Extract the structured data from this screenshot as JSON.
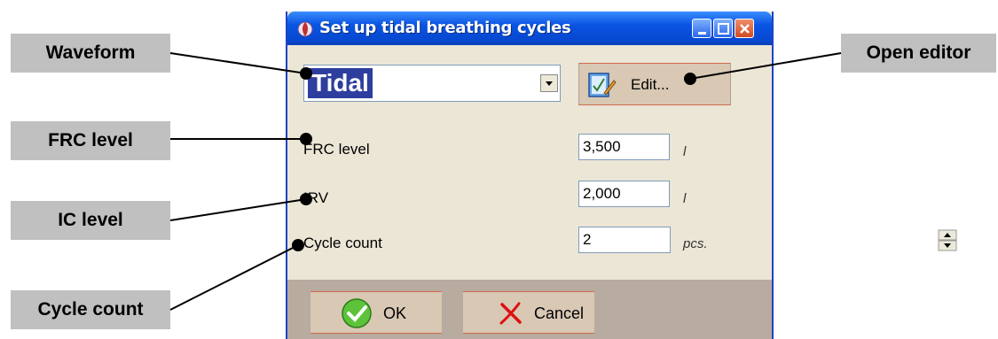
{
  "callouts": {
    "waveform": "Waveform",
    "frc_level": "FRC level",
    "ic_level": "IC level",
    "cycle_count": "Cycle count",
    "open_editor": "Open editor"
  },
  "dialog": {
    "title": "Set up tidal breathing cycles",
    "waveform_selected": "Tidal",
    "edit_label": "Edit...",
    "fields": [
      {
        "label": "FRC level",
        "value": "3,500",
        "unit": "l"
      },
      {
        "label": "IRV",
        "value": "2,000",
        "unit": "l"
      },
      {
        "label": "Cycle count",
        "value": "2",
        "unit": "pcs."
      }
    ],
    "ok_label": "OK",
    "cancel_label": "Cancel"
  },
  "colors": {
    "titlebar": "#0a54e3",
    "callout_bg": "#c0c0c0",
    "dialog_bg": "#ece6d6",
    "selection": "#2d3e9e"
  }
}
